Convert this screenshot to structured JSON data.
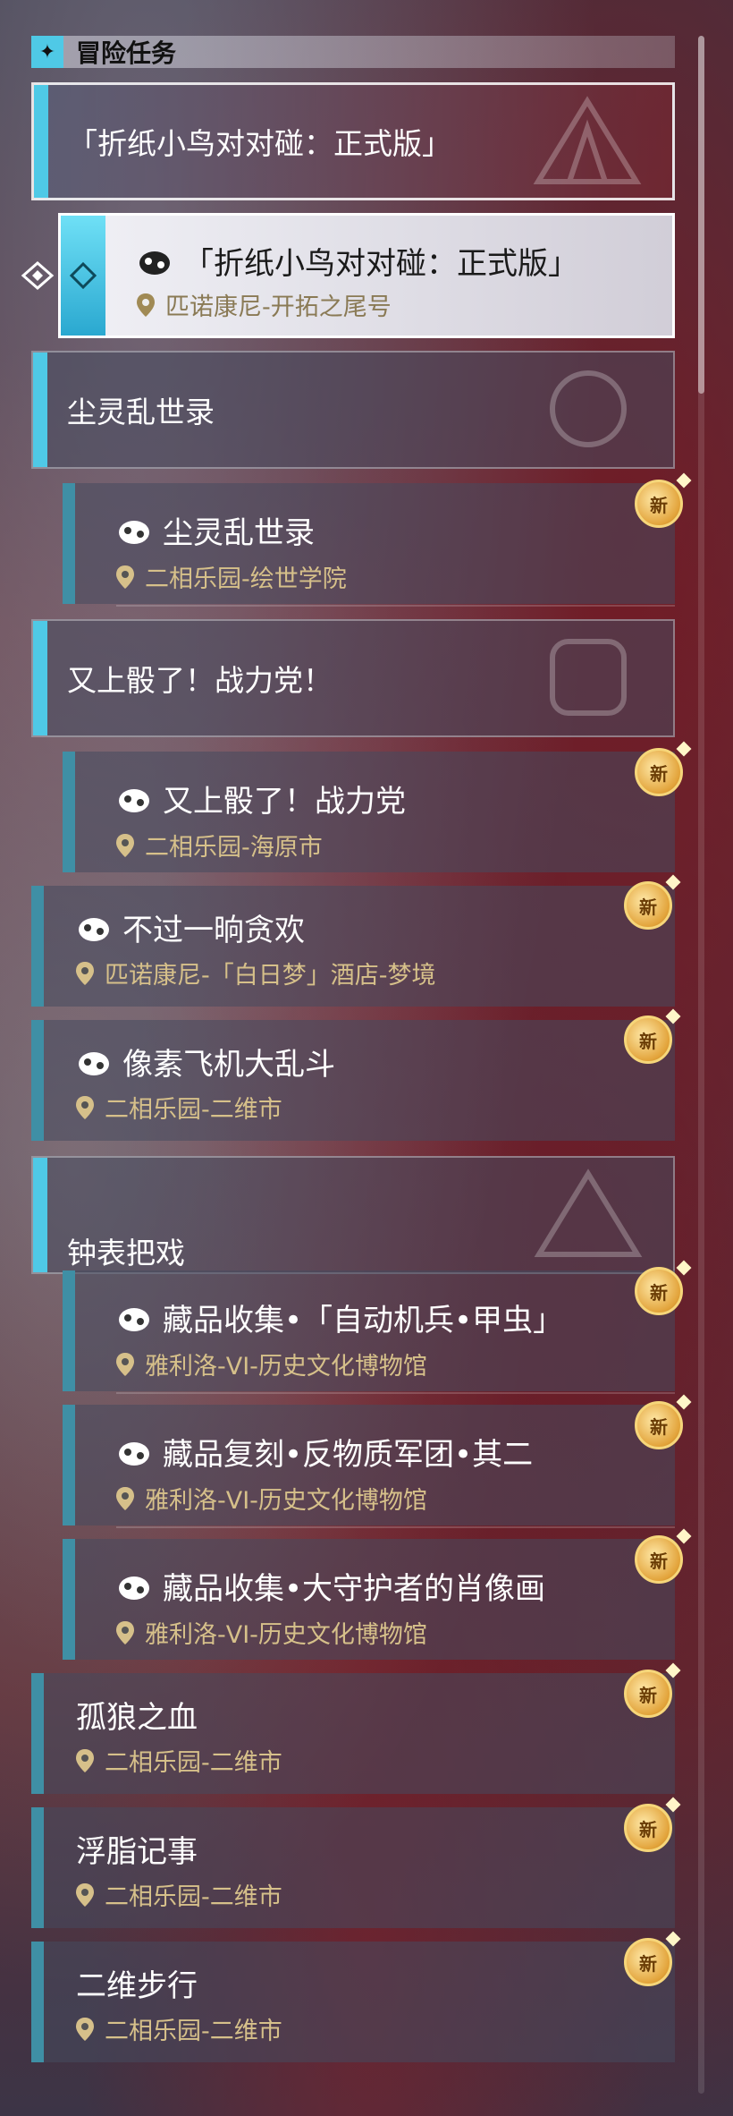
{
  "header": {
    "title": "冒险任务",
    "icon": "compass-star-icon"
  },
  "colors": {
    "accent": "#4fc9e6",
    "location": "#d6c08a",
    "new_badge": "#e2a33a"
  },
  "groups": [
    {
      "title": "「折纸小鸟对对碰：正式版」"
    },
    {
      "title": "尘灵乱世录"
    },
    {
      "title": "又上骰了！战力党！"
    },
    {
      "title": "钟表把戏"
    }
  ],
  "active_task": {
    "title": "「折纸小鸟对对碰：正式版」",
    "location": "匹诺康尼-开拓之尾号"
  },
  "tasks": [
    {
      "title": "尘灵乱世录",
      "location": "二相乐园-绘世学院",
      "badge": "新"
    },
    {
      "title": "又上骰了！战力党",
      "location": "二相乐园-海原市",
      "badge": "新"
    },
    {
      "title": "不过一晌贪欢",
      "location": "匹诺康尼-「白日梦」酒店-梦境",
      "badge": "新"
    },
    {
      "title": "像素飞机大乱斗",
      "location": "二相乐园-二维市",
      "badge": "新"
    },
    {
      "title": "藏品收集•「自动机兵•甲虫」",
      "location": "雅利洛-VI-历史文化博物馆",
      "badge": "新"
    },
    {
      "title": "藏品复刻•反物质军团•其二",
      "location": "雅利洛-VI-历史文化博物馆",
      "badge": "新"
    },
    {
      "title": "藏品收集•大守护者的肖像画",
      "location": "雅利洛-VI-历史文化博物馆",
      "badge": "新"
    },
    {
      "title": "孤狼之血",
      "location": "二相乐园-二维市",
      "badge": "新"
    },
    {
      "title": "浮脂记事",
      "location": "二相乐园-二维市",
      "badge": "新"
    },
    {
      "title": "二维步行",
      "location": "二相乐园-二维市",
      "badge": "新"
    }
  ]
}
